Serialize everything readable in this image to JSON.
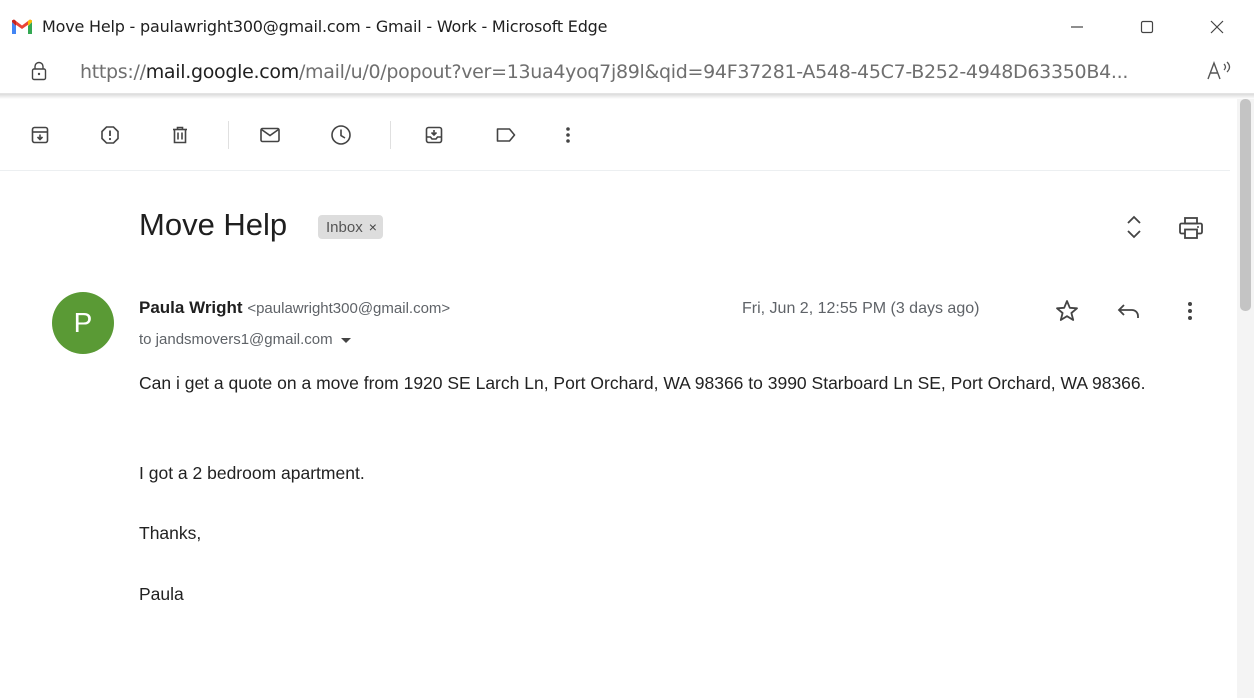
{
  "window": {
    "title": "Move Help - paulawright300@gmail.com - Gmail - Work - Microsoft Edge",
    "logo_icon": "gmail-logo-icon",
    "controls": [
      "minimize-icon",
      "maximize-icon",
      "close-icon"
    ]
  },
  "address_bar": {
    "scheme": "https://",
    "domain": "mail.google.com",
    "path": "/mail/u/0/popout?ver=13ua4yoq7j89l&qid=94F37281-A548-45C7-B252-4948D63350B4..."
  },
  "toolbar": {
    "icons": [
      "archive-icon",
      "report-spam-icon",
      "delete-icon",
      "mark-unread-icon",
      "snooze-icon",
      "move-to-icon",
      "label-icon",
      "more-vert-icon"
    ]
  },
  "email": {
    "subject": "Move Help",
    "label": "Inbox",
    "label_remove": "×",
    "sender": {
      "initial": "P",
      "avatar_color": "#5a9a35",
      "name": "Paula Wright",
      "email": "<paulawright300@gmail.com>"
    },
    "to": "to jandsmovers1@gmail.com",
    "date": "Fri, Jun 2, 12:55 PM (3 days ago)",
    "body": [
      "Can i get a quote on a move from 1920 SE Larch Ln, Port Orchard, WA 98366 to 3990 Starboard Ln SE, Port Orchard, WA 98366.",
      "I got a 2 bedroom apartment.",
      "Thanks,",
      "Paula"
    ]
  }
}
